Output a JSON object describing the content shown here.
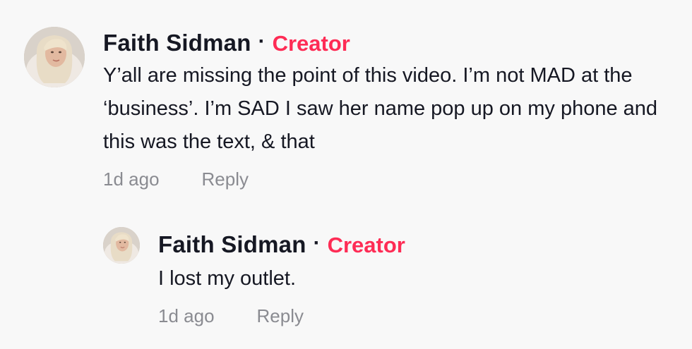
{
  "comments": [
    {
      "author": "Faith Sidman",
      "separator": "·",
      "badge": "Creator",
      "text": "Y’all are missing the point of this video. I’m not MAD at the ‘business’. I’m SAD I saw her name pop up on my phone and this was the text, & that",
      "time": "1d ago",
      "reply_label": "Reply",
      "avatar_icon": "user-avatar"
    },
    {
      "author": "Faith Sidman",
      "separator": "·",
      "badge": "Creator",
      "text": "I lost my outlet.",
      "time": "1d ago",
      "reply_label": "Reply",
      "avatar_icon": "user-avatar"
    }
  ],
  "colors": {
    "badge": "#fe2c55",
    "text": "#161823",
    "meta": "#8a8b91",
    "background": "#f8f8f8"
  }
}
